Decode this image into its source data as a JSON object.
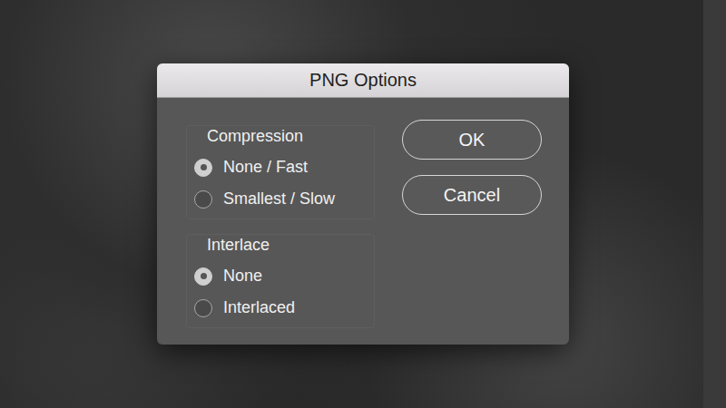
{
  "window": {
    "title": "PNG Options"
  },
  "groups": [
    {
      "label": "Compression",
      "options": [
        {
          "label": "None / Fast",
          "selected": true
        },
        {
          "label": "Smallest / Slow",
          "selected": false
        }
      ]
    },
    {
      "label": "Interlace",
      "options": [
        {
          "label": "None",
          "selected": true
        },
        {
          "label": "Interlaced",
          "selected": false
        }
      ]
    }
  ],
  "buttons": [
    {
      "label": "OK"
    },
    {
      "label": "Cancel"
    }
  ]
}
